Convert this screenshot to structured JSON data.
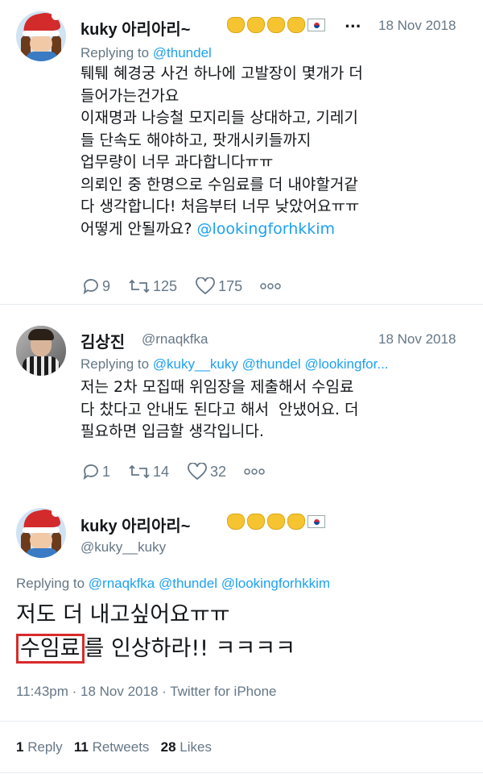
{
  "tweet1": {
    "name": "kuky 아리아리~",
    "date": "18 Nov 2018",
    "replying_prefix": "Replying to ",
    "replying_mentions": "@thundel",
    "text_lines": [
      "퉤퉤 혜경궁 사건 하나에 고발장이 몇개가 더",
      "들어가는건가요",
      "이재명과 나승철 모지리들 상대하고, 기레기",
      "들 단속도 해야하고, 팟개시키들까지",
      "업무량이 너무 과다합니다ㅠㅠ",
      "의뢰인 중 한명으로 수임료를 더 내야할거같",
      "다 생각합니다! 처음부터 너무 낮았어요ㅠㅠ"
    ],
    "last_line_text": "어떻게 안될까요? ",
    "last_line_mention": "@lookingforhkkim",
    "replies": "9",
    "retweets": "125",
    "likes": "175"
  },
  "tweet2": {
    "name": "김상진",
    "handle": "@rnaqkfka",
    "date": "18 Nov 2018",
    "replying_prefix": "Replying to ",
    "replying_mentions": "@kuky__kuky @thundel @lookingfor...",
    "text_lines": [
      "저는 2차 모집때 위임장을 제출해서 수임료",
      "다 찼다고 안내도 된다고 해서  안냈어요. 더",
      "필요하면 입금할 생각입니다."
    ],
    "replies": "1",
    "retweets": "14",
    "likes": "32"
  },
  "tweet3": {
    "name": "kuky 아리아리~",
    "handle": "@kuky__kuky",
    "replying_prefix": "Replying to ",
    "replying_mentions": "@rnaqkfka @thundel @lookingforhkkim",
    "line1": "저도 더 내고싶어요ㅠㅠ",
    "highlight": "수임료",
    "line2_rest": "를 인상하라!! ㅋㅋㅋㅋ",
    "meta": "11:43pm · 18 Nov 2018 · Twitter for iPhone",
    "stats": {
      "reply_count": "1",
      "reply_label": "Reply",
      "retweet_count": "11",
      "retweet_label": "Retweets",
      "like_count": "28",
      "like_label": "Likes"
    }
  },
  "icons": {
    "reply": "reply-icon",
    "retweet": "retweet-icon",
    "like": "heart-icon",
    "more": "more-dots-icon"
  },
  "colors": {
    "link": "#1da1f2",
    "muted": "#657786",
    "highlight_border": "#d92a2a"
  }
}
